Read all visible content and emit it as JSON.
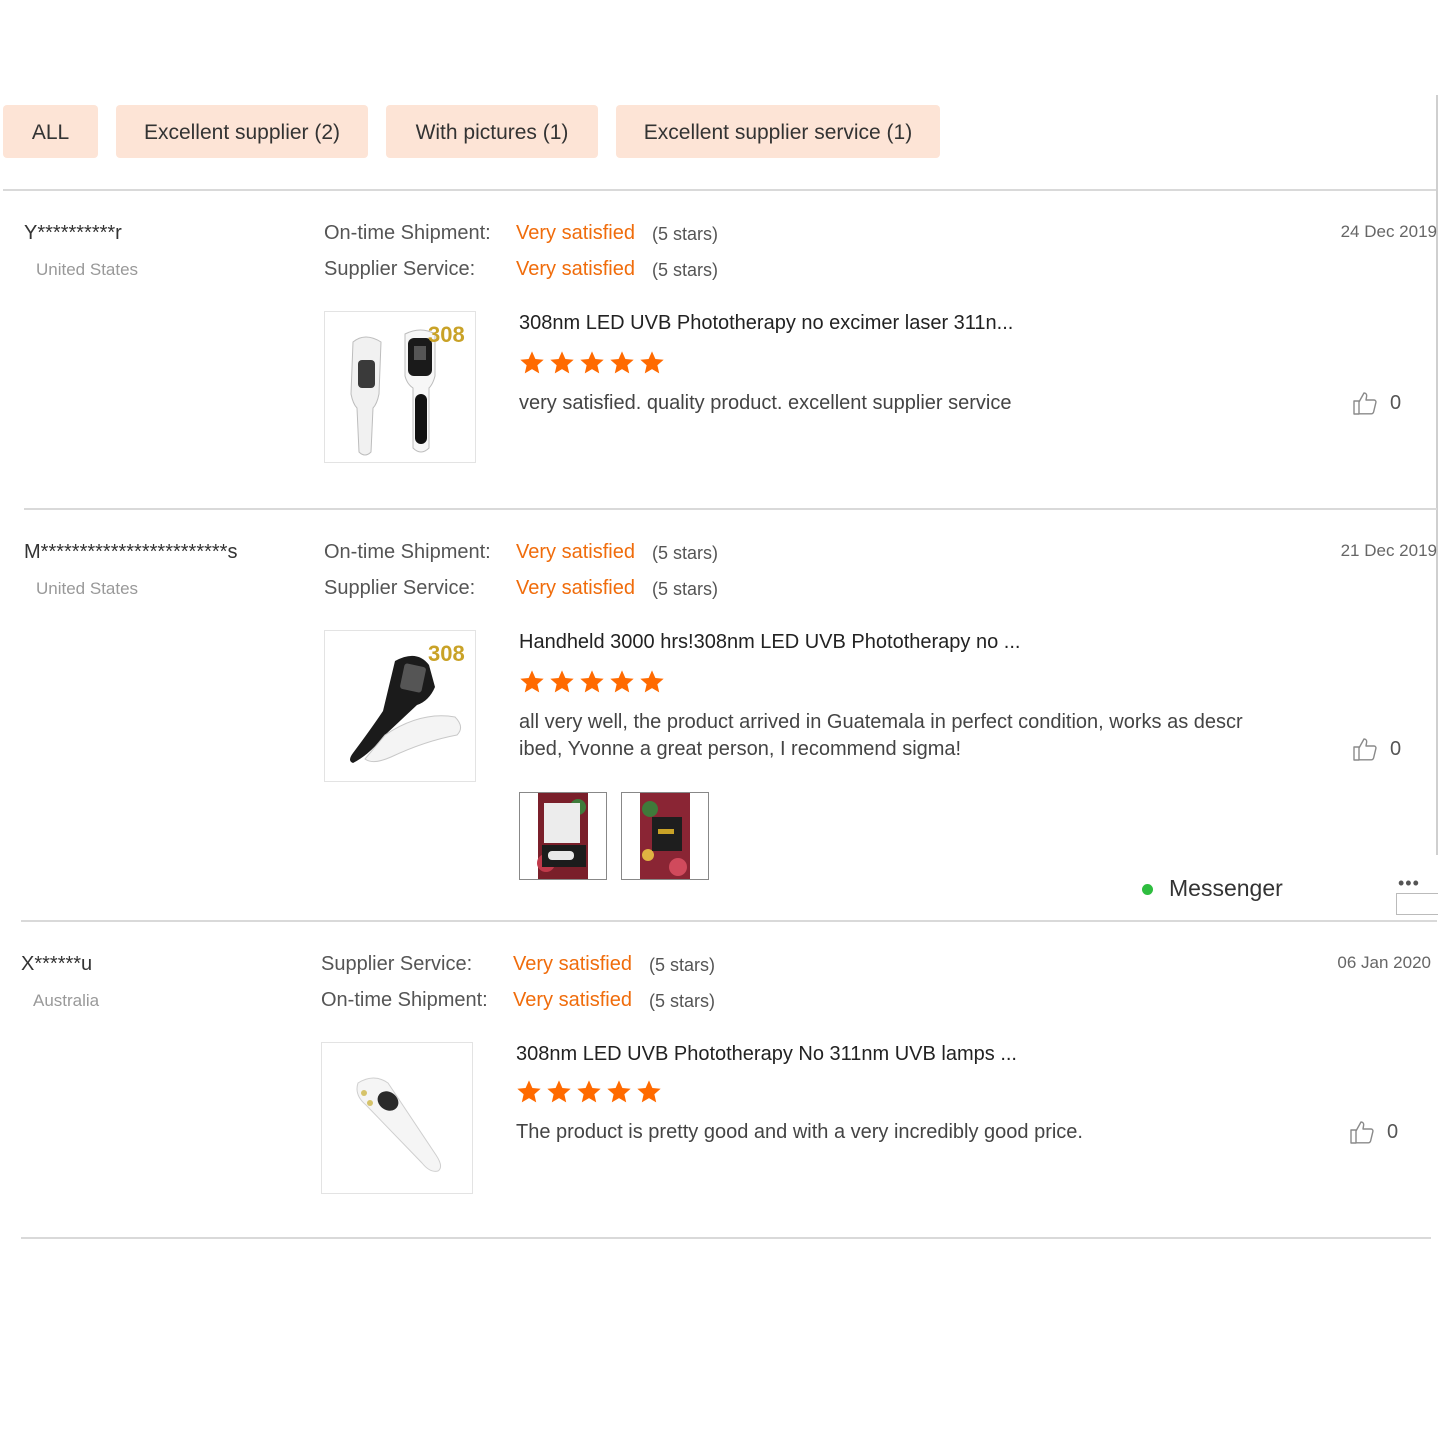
{
  "filters": [
    {
      "label": "ALL"
    },
    {
      "label": "Excellent supplier (2)"
    },
    {
      "label": "With pictures (1)"
    },
    {
      "label": "Excellent supplier service (1)"
    }
  ],
  "reviews": [
    {
      "user": "Y**********r",
      "country": "United States",
      "date": "24 Dec 2019",
      "attributes": [
        {
          "label": "On-time Shipment:",
          "value": "Very satisfied",
          "stars": "(5 stars)"
        },
        {
          "label": "Supplier Service:",
          "value": "Very satisfied",
          "stars": "(5 stars)"
        }
      ],
      "product_badge": "308",
      "product_title": "308nm LED UVB Phototherapy no excimer laser 311n...",
      "rating": 5,
      "comment": "very satisfied.  quality product.  excellent supplier service",
      "likes": "0"
    },
    {
      "user": "M************************s",
      "country": "United States",
      "date": "21 Dec 2019",
      "attributes": [
        {
          "label": "On-time Shipment:",
          "value": "Very satisfied",
          "stars": "(5 stars)"
        },
        {
          "label": "Supplier Service:",
          "value": "Very satisfied",
          "stars": "(5 stars)"
        }
      ],
      "product_badge": "308",
      "product_title": "Handheld 3000 hrs!308nm LED UVB Phototherapy no ...",
      "rating": 5,
      "comment_line1": "all very well, the product arrived in Guatemala in perfect condition, works as descr",
      "comment_line2": "ibed, Yvonne a great person, I recommend sigma!",
      "likes": "0",
      "photo_count": 2
    },
    {
      "user": "X******u",
      "country": "Australia",
      "date": "06 Jan 2020",
      "attributes": [
        {
          "label": "Supplier Service:",
          "value": "Very satisfied",
          "stars": "(5 stars)"
        },
        {
          "label": "On-time Shipment:",
          "value": "Very satisfied",
          "stars": "(5 stars)"
        }
      ],
      "product_title": "308nm LED UVB Phototherapy No 311nm UVB lamps ...",
      "rating": 5,
      "comment": "The product is pretty good and with a very incredibly good price.",
      "likes": "0"
    }
  ],
  "messenger": {
    "label": "Messenger",
    "more": "•••",
    "status_color": "#2ebd3f"
  },
  "colors": {
    "accent": "#f06c0b",
    "chip_bg": "#fde4d6",
    "star": "#ff6a00"
  },
  "icons": {
    "like": "thumbs-up-icon",
    "star": "star-icon",
    "online": "online-status-dot"
  }
}
